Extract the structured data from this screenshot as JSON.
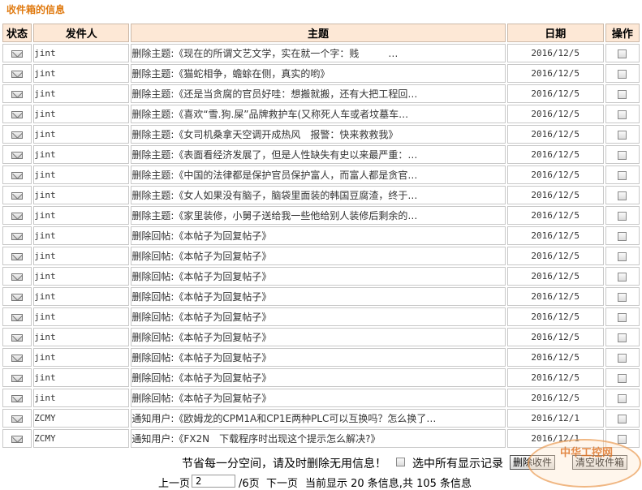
{
  "title": "收件箱的信息",
  "columns": {
    "status": "状态",
    "sender": "发件人",
    "subject": "主题",
    "date": "日期",
    "action": "操作"
  },
  "messages": [
    {
      "sender": "jint",
      "subject": "删除主题:《现在的所谓文艺文学，实在就一个字：贱　　　…",
      "date": "2016/12/5"
    },
    {
      "sender": "jint",
      "subject": "删除主题:《猫蛇相争，蟾蜍在侧，真实的哟》",
      "date": "2016/12/5"
    },
    {
      "sender": "jint",
      "subject": "删除主题:《还是当贪腐的官员好哇：想搬就搬，还有大把工程回…",
      "date": "2016/12/5"
    },
    {
      "sender": "jint",
      "subject": "删除主题:《喜欢“雪.狗.屎”品牌救护车(又称死人车或者坟墓车…",
      "date": "2016/12/5"
    },
    {
      "sender": "jint",
      "subject": "删除主题:《女司机桑拿天空调开成热风　报警：快来救救我》",
      "date": "2016/12/5"
    },
    {
      "sender": "jint",
      "subject": "删除主题:《表面看经济发展了，但是人性缺失有史以来最严重：…",
      "date": "2016/12/5"
    },
    {
      "sender": "jint",
      "subject": "删除主题:《中国的法律都是保护官员保护富人，而富人都是贪官…",
      "date": "2016/12/5"
    },
    {
      "sender": "jint",
      "subject": "删除主题:《女人如果没有脑子，脑袋里面装的韩国豆腐渣，终于…",
      "date": "2016/12/5"
    },
    {
      "sender": "jint",
      "subject": "删除主题:《家里装修，小舅子送给我一些他给别人装修后剩余的…",
      "date": "2016/12/5"
    },
    {
      "sender": "jint",
      "subject": "删除回帖:《本帖子为回复帖子》",
      "date": "2016/12/5"
    },
    {
      "sender": "jint",
      "subject": "删除回帖:《本帖子为回复帖子》",
      "date": "2016/12/5"
    },
    {
      "sender": "jint",
      "subject": "删除回帖:《本帖子为回复帖子》",
      "date": "2016/12/5"
    },
    {
      "sender": "jint",
      "subject": "删除回帖:《本帖子为回复帖子》",
      "date": "2016/12/5"
    },
    {
      "sender": "jint",
      "subject": "删除回帖:《本帖子为回复帖子》",
      "date": "2016/12/5"
    },
    {
      "sender": "jint",
      "subject": "删除回帖:《本帖子为回复帖子》",
      "date": "2016/12/5"
    },
    {
      "sender": "jint",
      "subject": "删除回帖:《本帖子为回复帖子》",
      "date": "2016/12/5"
    },
    {
      "sender": "jint",
      "subject": "删除回帖:《本帖子为回复帖子》",
      "date": "2016/12/5"
    },
    {
      "sender": "jint",
      "subject": "删除回帖:《本帖子为回复帖子》",
      "date": "2016/12/5"
    },
    {
      "sender": "ZCMY",
      "subject": "通知用户:《欧姆龙的CPM1A和CP1E两种PLC可以互换吗？怎么换了…",
      "date": "2016/12/1"
    },
    {
      "sender": "ZCMY",
      "subject": "通知用户:《FX2N　下载程序时出现这个提示怎么解决?》",
      "date": "2016/12/1"
    }
  ],
  "footer": {
    "note": "节省每一分空间，请及时删除无用信息！",
    "select_all_label": "选中所有显示记录",
    "delete_button": "删除收件",
    "clear_button": "清空收件箱"
  },
  "pagination": {
    "prev": "上一页",
    "page_value": "2",
    "total_pages": "/6页",
    "next": "下一页",
    "summary": "当前显示 20 条信息,共 105 条信息"
  },
  "watermark": "中华工控网"
}
